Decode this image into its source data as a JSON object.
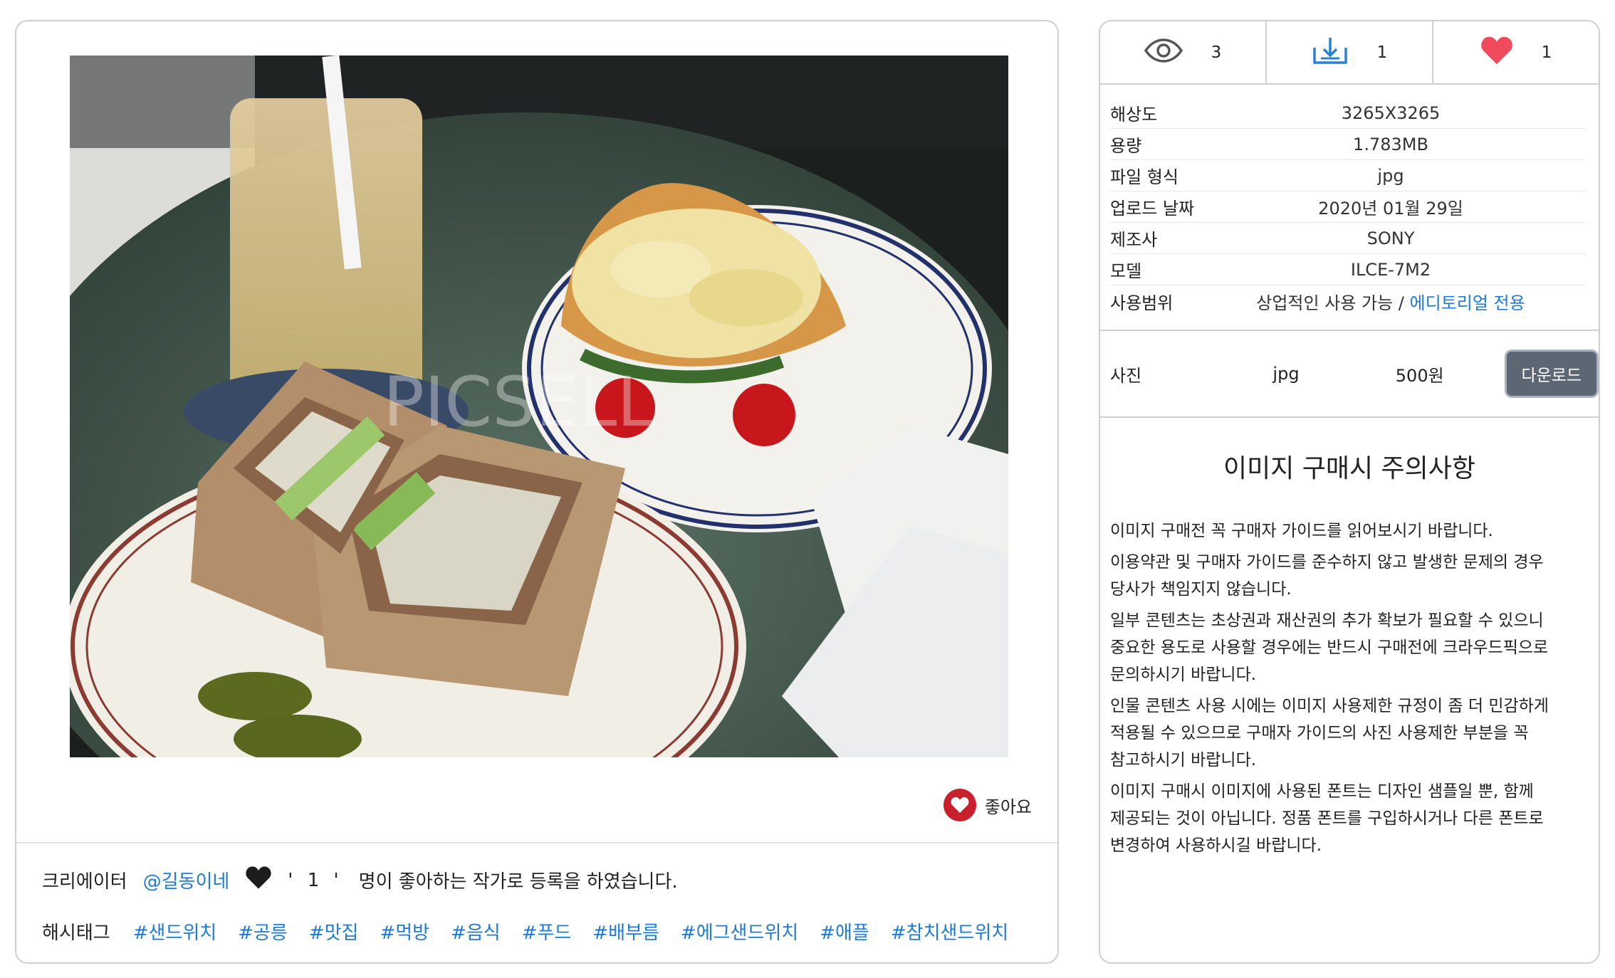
{
  "photo": {
    "watermark": "PICSELL"
  },
  "like_button": {
    "label": "좋아요",
    "icon": "heart-icon"
  },
  "creator": {
    "label": "크리에이터",
    "name": "@길동이네",
    "count_text": "' 1 '",
    "suffix": "명이 좋아하는 작가로 등록을 하였습니다."
  },
  "hashtags": {
    "label": "해시태그",
    "tags": [
      "#샌드위치",
      "#공릉",
      "#맛집",
      "#먹방",
      "#음식",
      "#푸드",
      "#배부름",
      "#에그샌드위치",
      "#애플",
      "#참치샌드위치"
    ]
  },
  "stats": {
    "views": "3",
    "downloads": "1",
    "likes": "1"
  },
  "info": [
    {
      "key": "해상도",
      "value": "3265X3265"
    },
    {
      "key": "용량",
      "value": "1.783MB"
    },
    {
      "key": "파일 형식",
      "value": "jpg"
    },
    {
      "key": "업로드 날짜",
      "value": "2020년 01월 29일"
    },
    {
      "key": "제조사",
      "value": "SONY"
    },
    {
      "key": "모델",
      "value": "ILCE-7M2"
    }
  ],
  "usage": {
    "key": "사용범위",
    "commercial": "상업적인 사용 가능 /",
    "editorial": "에디토리얼 전용"
  },
  "purchase": {
    "label": "사진",
    "format": "jpg",
    "price": "500원",
    "button": "다운로드"
  },
  "notice": {
    "title": "이미지 구매시 주의사항",
    "paragraphs": [
      "이미지 구매전 꼭 구매자 가이드를 읽어보시기 바랍니다.",
      "이용약관 및 구매자 가이드를 준수하지 않고 발생한 문제의 경우 당사가 책임지지 않습니다.",
      "일부 콘텐츠는 초상권과 재산권의 추가 확보가 필요할 수 있으니 중요한 용도로 사용할 경우에는 반드시 구매전에 크라우드픽으로 문의하시기 바랍니다.",
      "인물 콘텐츠 사용 시에는 이미지 사용제한 규정이 좀 더 민감하게 적용될 수 있으므로 구매자 가이드의 사진 사용제한 부분을 꼭 참고하시기 바랍니다.",
      "이미지 구매시 이미지에 사용된 폰트는 디자인 샘플일 뿐, 함께 제공되는 것이 아닙니다. 정품 폰트를 구입하시거나 다른 폰트로 변경하여 사용하시길 바랍니다."
    ]
  },
  "colors": {
    "accent_blue": "#1f79d6",
    "like_red": "#c8202d",
    "heart_pink": "#ef4b5c",
    "button_gray": "#5c6773"
  }
}
